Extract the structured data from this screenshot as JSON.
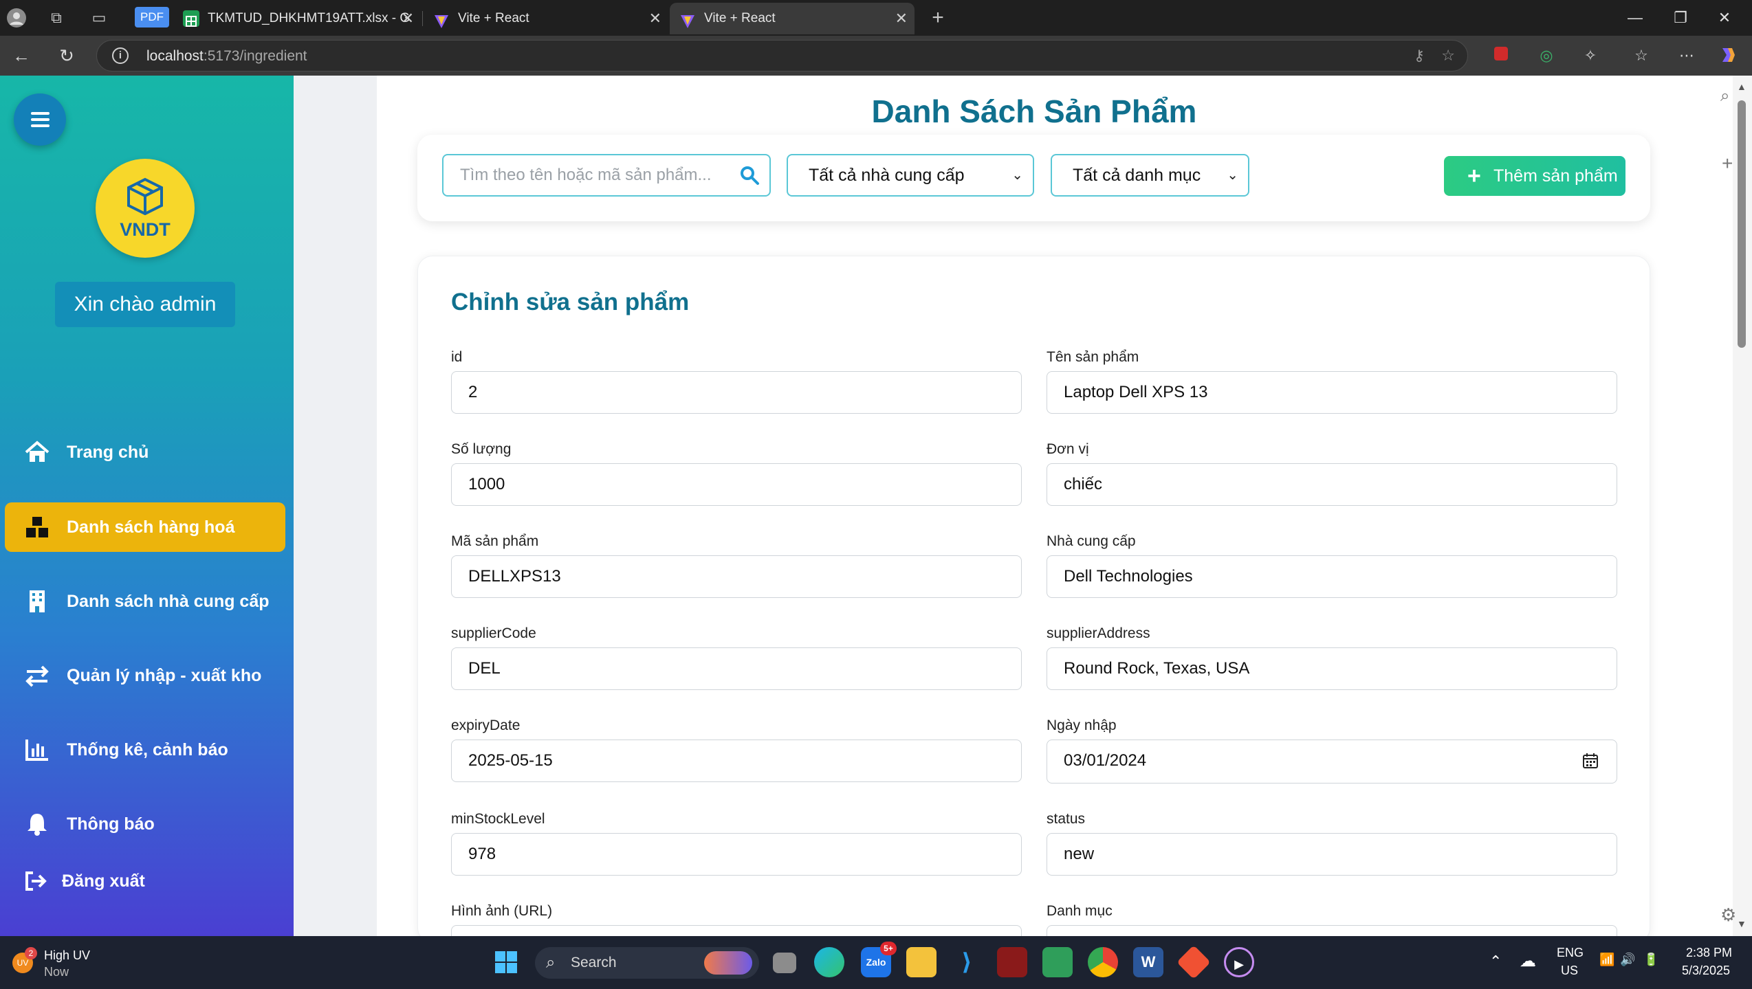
{
  "browser": {
    "tabs": [
      {
        "label": "TKMTUD_DHKHMT19ATT.xlsx - G",
        "favicon": "sheets-icon"
      },
      {
        "label": "Vite + React",
        "favicon": "vite-icon"
      },
      {
        "label": "Vite + React",
        "favicon": "vite-icon",
        "active": true
      }
    ],
    "pdf_badge": "PDF",
    "url_host": "localhost",
    "url_path": ":5173/ingredient"
  },
  "sidebar": {
    "logo_text": "VNDT",
    "greeting": "Xin chào  admin",
    "items": [
      {
        "label": "Trang chủ",
        "icon": "home-icon"
      },
      {
        "label": "Danh sách hàng hoá",
        "icon": "boxes-icon",
        "active": true
      },
      {
        "label": "Danh sách nhà cung cấp",
        "icon": "building-icon"
      },
      {
        "label": "Quản lý nhập - xuất kho",
        "icon": "exchange-icon"
      },
      {
        "label": "Thống kê, cảnh báo",
        "icon": "chart-icon"
      },
      {
        "label": "Thông báo",
        "icon": "bell-icon"
      }
    ],
    "logout": "Đăng xuất"
  },
  "page": {
    "title": "Danh Sách Sản Phẩm",
    "search_placeholder": "Tìm theo tên hoặc mã sản phẩm...",
    "supplier_filter": "Tất cả nhà cung cấp",
    "category_filter": "Tất cả danh mục",
    "add_button": "Thêm sản phẩm"
  },
  "form": {
    "title": "Chỉnh sửa sản phẩm",
    "fields": {
      "id": {
        "label": "id",
        "value": "2"
      },
      "name": {
        "label": "Tên sản phẩm",
        "value": "Laptop Dell XPS 13"
      },
      "quantity": {
        "label": "Số lượng",
        "value": "1000"
      },
      "unit": {
        "label": "Đơn vị",
        "value": "chiếc"
      },
      "code": {
        "label": "Mã sản phẩm",
        "value": "DELLXPS13"
      },
      "supplier": {
        "label": "Nhà cung cấp",
        "value": "Dell Technologies"
      },
      "supplierCode": {
        "label": "supplierCode",
        "value": "DEL"
      },
      "supplierAddress": {
        "label": "supplierAddress",
        "value": "Round Rock, Texas, USA"
      },
      "expiryDate": {
        "label": "expiryDate",
        "value": "2025-05-15"
      },
      "importDate": {
        "label": "Ngày nhập",
        "value": "03/01/2024"
      },
      "minStockLevel": {
        "label": "minStockLevel",
        "value": "978"
      },
      "status": {
        "label": "status",
        "value": "new"
      },
      "image": {
        "label": "Hình ảnh (URL)",
        "value": ""
      },
      "category": {
        "label": "Danh mục",
        "value": ""
      }
    }
  },
  "taskbar": {
    "weather_title": "High UV",
    "weather_sub": "Now",
    "weather_badge": "2",
    "search": "Search",
    "lang_top": "ENG",
    "lang_bottom": "US",
    "time": "2:38 PM",
    "date": "5/3/2025",
    "zalo_badge": "5+"
  },
  "colors": {
    "accent": "#10708e",
    "active_nav": "#ecb40c",
    "add_button": "#2ccb83",
    "input_border": "#5ac7d6"
  }
}
